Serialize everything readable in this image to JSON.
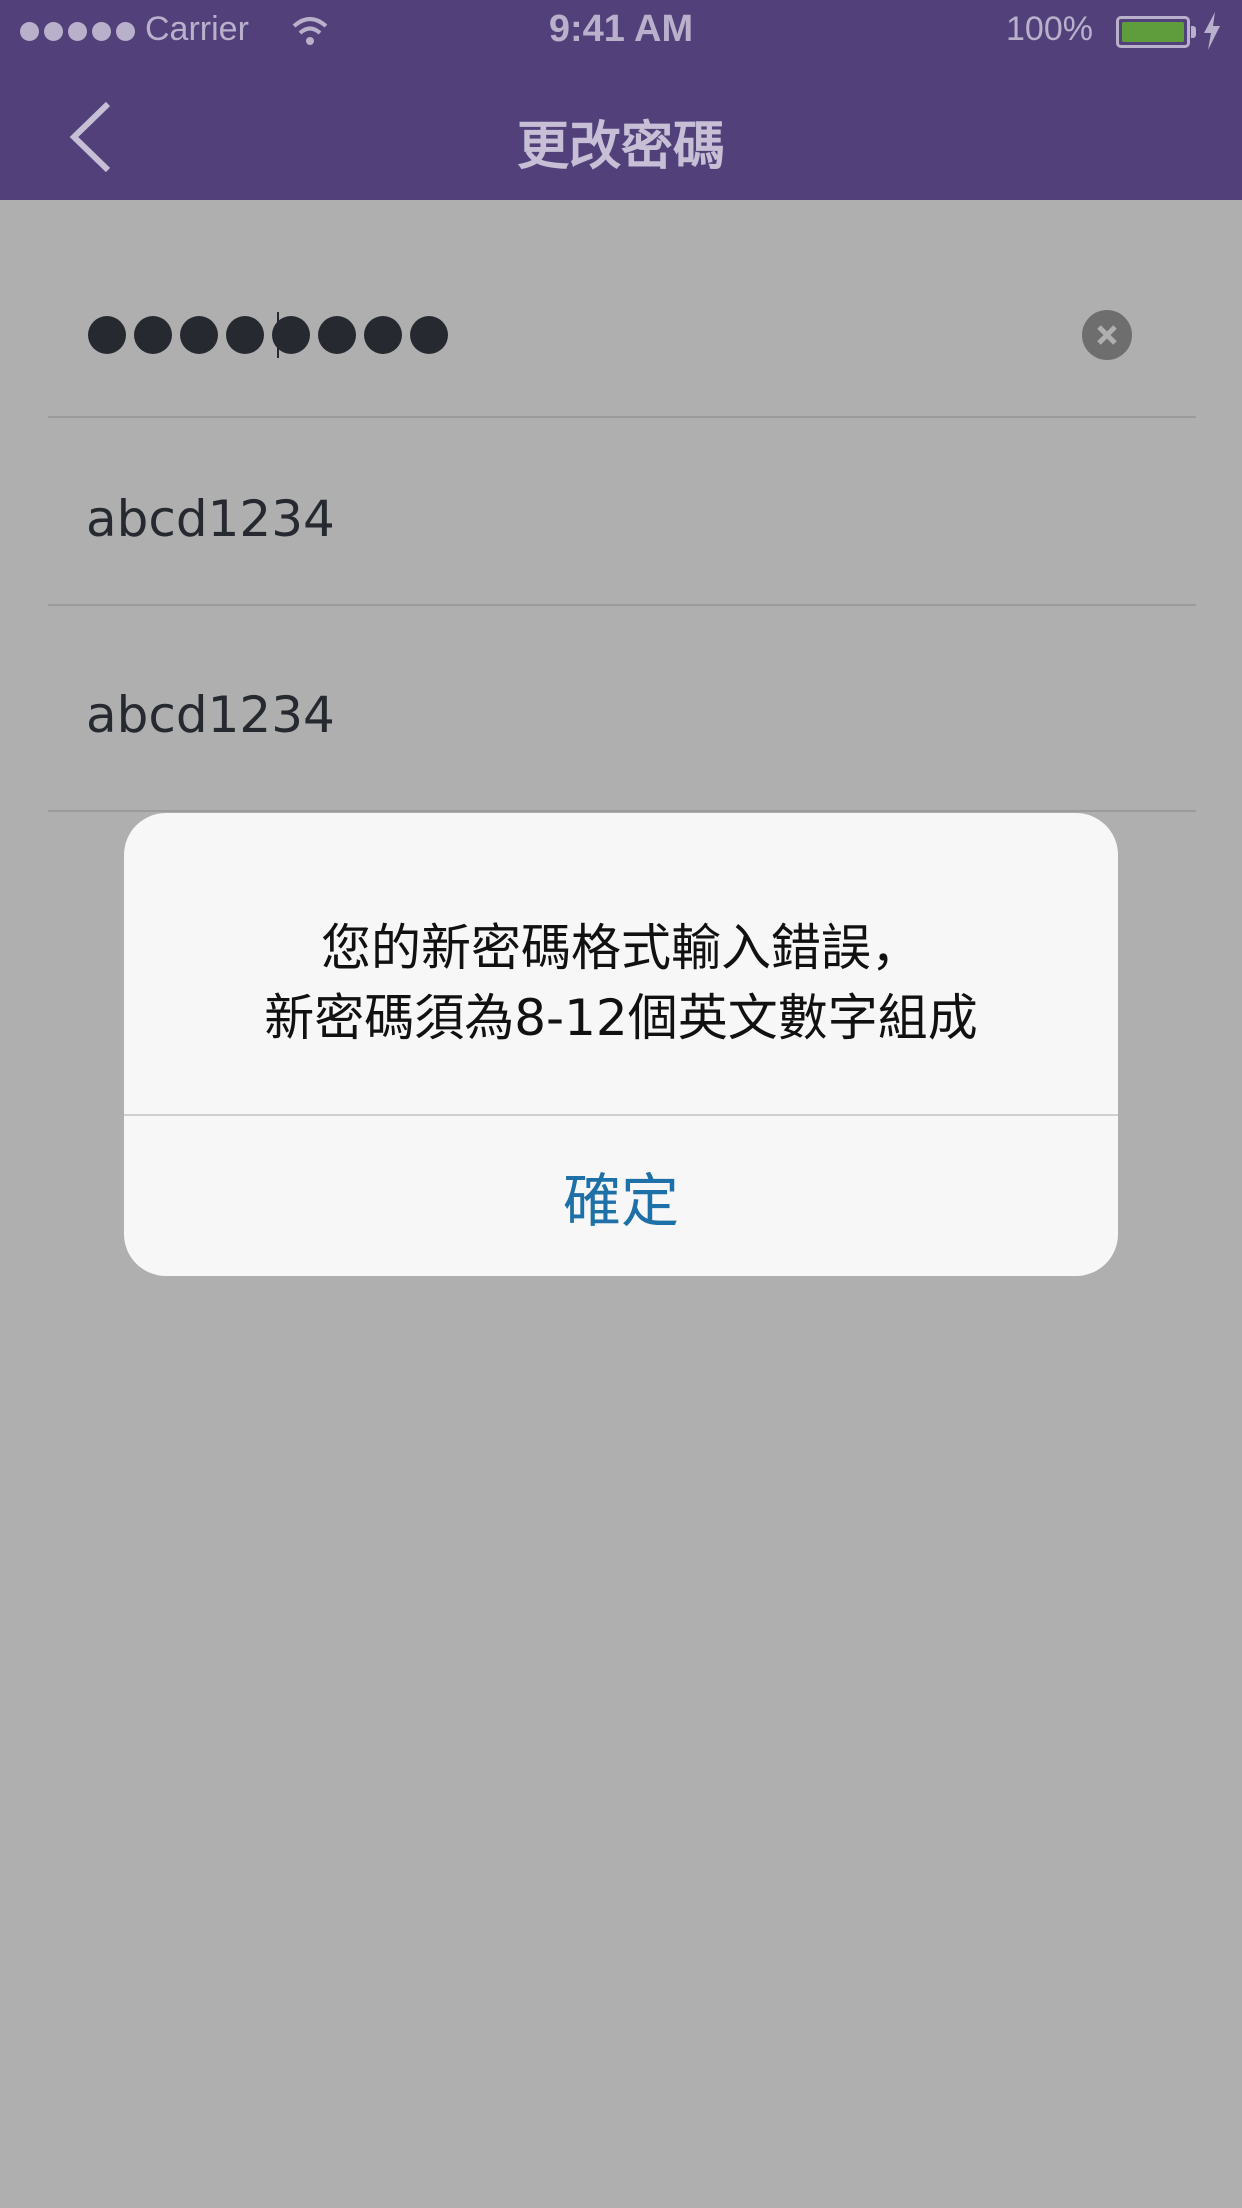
{
  "status_bar": {
    "carrier": "Carrier",
    "time": "9:41 AM",
    "battery": "100%"
  },
  "nav": {
    "title": "更改密碼"
  },
  "form": {
    "old_password_mask": "●●●●●●●●",
    "new_password": "abcd1234",
    "confirm_password": "abcd1234"
  },
  "alert": {
    "line1": "您的新密碼格式輸入錯誤，",
    "line2": "新密碼須為8-12個英文數字組成",
    "confirm_label": "確定"
  },
  "colors": {
    "nav": "#52407a",
    "accent": "#1e70a8",
    "battery": "#5f9d3c"
  }
}
